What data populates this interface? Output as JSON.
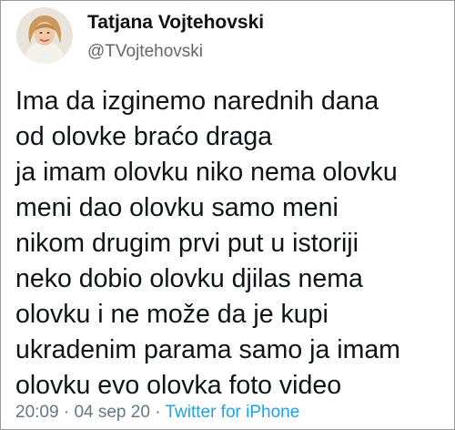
{
  "author": {
    "name": "Tatjana Vojtehovski",
    "handle": "@TVojtehovski"
  },
  "tweet": {
    "lines": [
      "Ima da izginemo narednih dana",
      "od olovke braćo draga",
      "ja imam olovku niko nema olovku",
      "meni dao olovku samo meni",
      "nikom drugim prvi put u istoriji",
      "neko dobio olovku djilas nema",
      "olovku i ne može da je kupi",
      "ukradenim parama samo ja imam",
      "olovku evo olovka foto video"
    ]
  },
  "meta": {
    "time": "20:09",
    "sep1": "·",
    "date": "04 sep 20",
    "sep2": "·",
    "source": "Twitter for iPhone"
  },
  "colors": {
    "link": "#1da1f2",
    "meta": "#657786"
  }
}
